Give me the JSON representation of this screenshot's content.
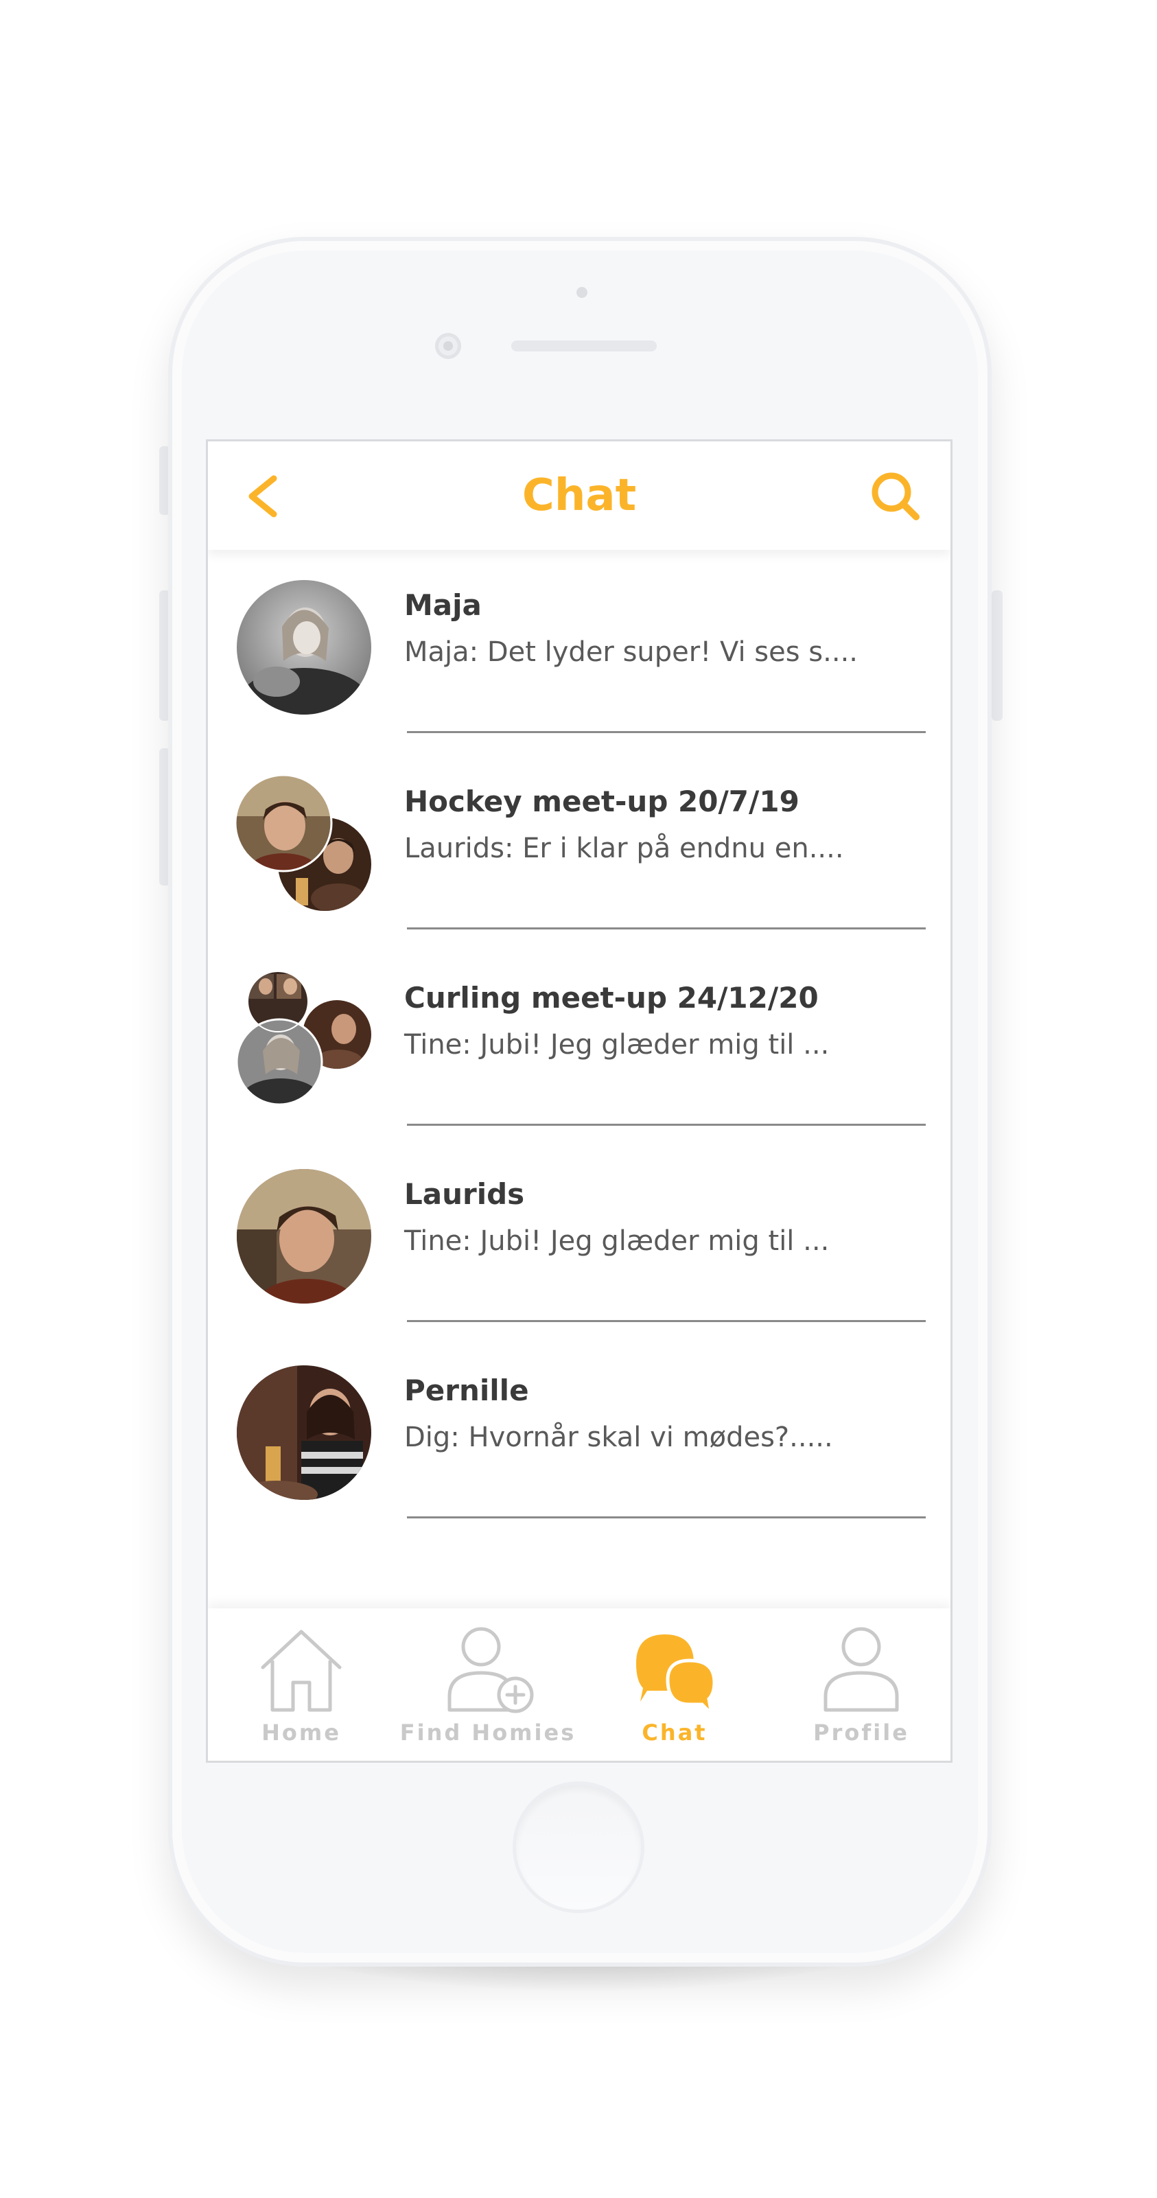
{
  "header": {
    "title": "Chat",
    "back_icon": "chevron-left-icon",
    "search_icon": "search-icon"
  },
  "chats": [
    {
      "name": "Maja",
      "preview": "Maja: Det lyder super! Vi ses s....",
      "avatar": "single-photo"
    },
    {
      "name": "Hockey meet-up 20/7/19",
      "preview": "Laurids: Er i klar på endnu en....",
      "avatar": "group-photo"
    },
    {
      "name": "Curling meet-up 24/12/20",
      "preview": "Tine: Jubi! Jeg glæder mig til ...",
      "avatar": "group-photo"
    },
    {
      "name": "Laurids",
      "preview": "Tine: Jubi! Jeg glæder mig til ...",
      "avatar": "single-photo"
    },
    {
      "name": "Pernille",
      "preview": "Dig: Hvornår skal vi mødes?.....",
      "avatar": "single-photo"
    }
  ],
  "tabs": [
    {
      "label": "Home",
      "icon": "home-icon",
      "active": false
    },
    {
      "label": "Find Homies",
      "icon": "add-user-icon",
      "active": false
    },
    {
      "label": "Chat",
      "icon": "chat-bubbles-icon",
      "active": true
    },
    {
      "label": "Profile",
      "icon": "user-icon",
      "active": false
    }
  ],
  "colors": {
    "accent": "#fbb42a",
    "inactive": "#c9c9c9",
    "text_dark": "#3a3a3a",
    "text_muted": "#595959"
  }
}
